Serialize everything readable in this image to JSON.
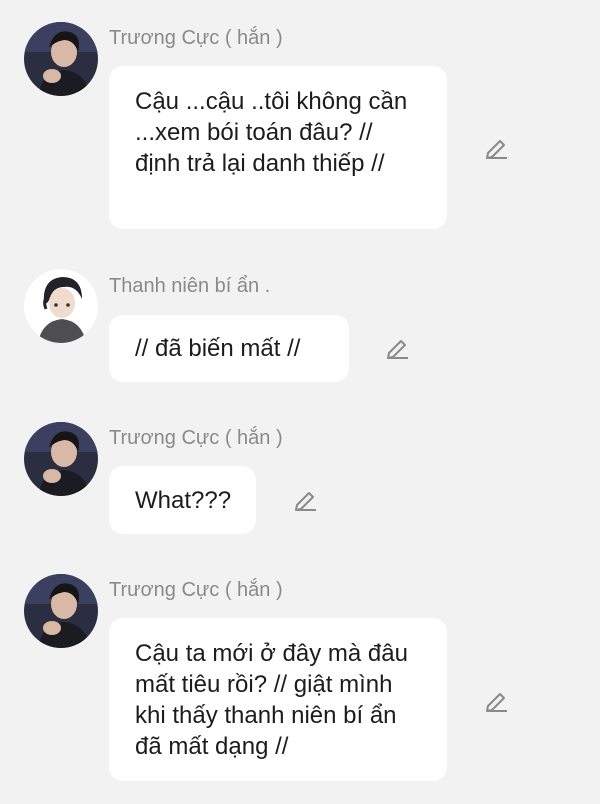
{
  "messages": [
    {
      "sender": "Trương Cực ( hắn )",
      "avatar": "dark-haired-man-avatar",
      "text": "Cậu ...cậu ..tôi không cần ...xem bói toán đâu? // định trả lại danh thiếp //"
    },
    {
      "sender": "Thanh niên bí ẩn .",
      "avatar": "anime-boy-avatar",
      "text": "// đã biến mất //"
    },
    {
      "sender": "Trương Cực ( hắn )",
      "avatar": "dark-haired-man-avatar",
      "text": "What???"
    },
    {
      "sender": "Trương Cực ( hắn )",
      "avatar": "dark-haired-man-avatar",
      "text": "Cậu ta mới ở đây mà đâu mất tiêu rồi? // giật mình khi thấy thanh niên bí ẩn đã mất dạng //"
    }
  ],
  "icons": {
    "edit": "pencil-icon"
  },
  "colors": {
    "background": "#f2f2f2",
    "bubble": "#ffffff",
    "name": "#8a8a8a",
    "text": "#1c1c1c"
  }
}
